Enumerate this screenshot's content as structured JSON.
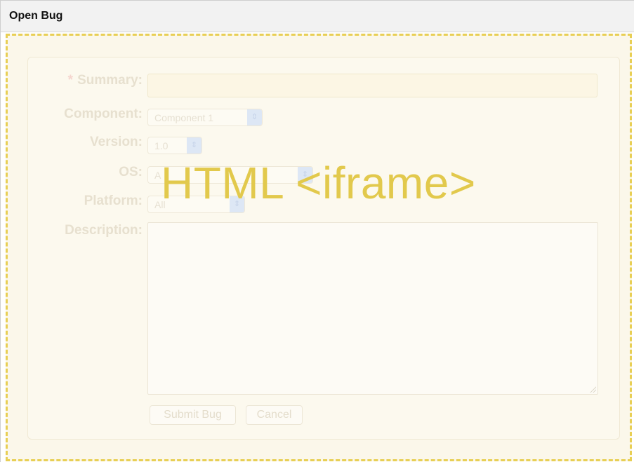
{
  "window": {
    "title": "Open Bug"
  },
  "overlay": {
    "text": "HTML <iframe>"
  },
  "form": {
    "summary": {
      "required_marker": "*",
      "label": "Summary:",
      "value": ""
    },
    "component": {
      "label": "Component:",
      "value": "Component 1"
    },
    "version": {
      "label": "Version:",
      "value": "1.0"
    },
    "os": {
      "label": "OS:",
      "value": "A"
    },
    "platform": {
      "label": "Platform:",
      "value": "All"
    },
    "description": {
      "label": "Description:",
      "value": ""
    },
    "buttons": {
      "submit_label": "Submit Bug",
      "cancel_label": "Cancel"
    }
  },
  "colors": {
    "dashed_border": "#e8cf55",
    "overlay_text": "#e2c94c",
    "faded_label": "#e7e0cf",
    "select_arrow": "#dde7f5"
  },
  "icons": {
    "select_arrow": "updown-chevron-icon",
    "resize_grip": "resize-grip-icon"
  }
}
